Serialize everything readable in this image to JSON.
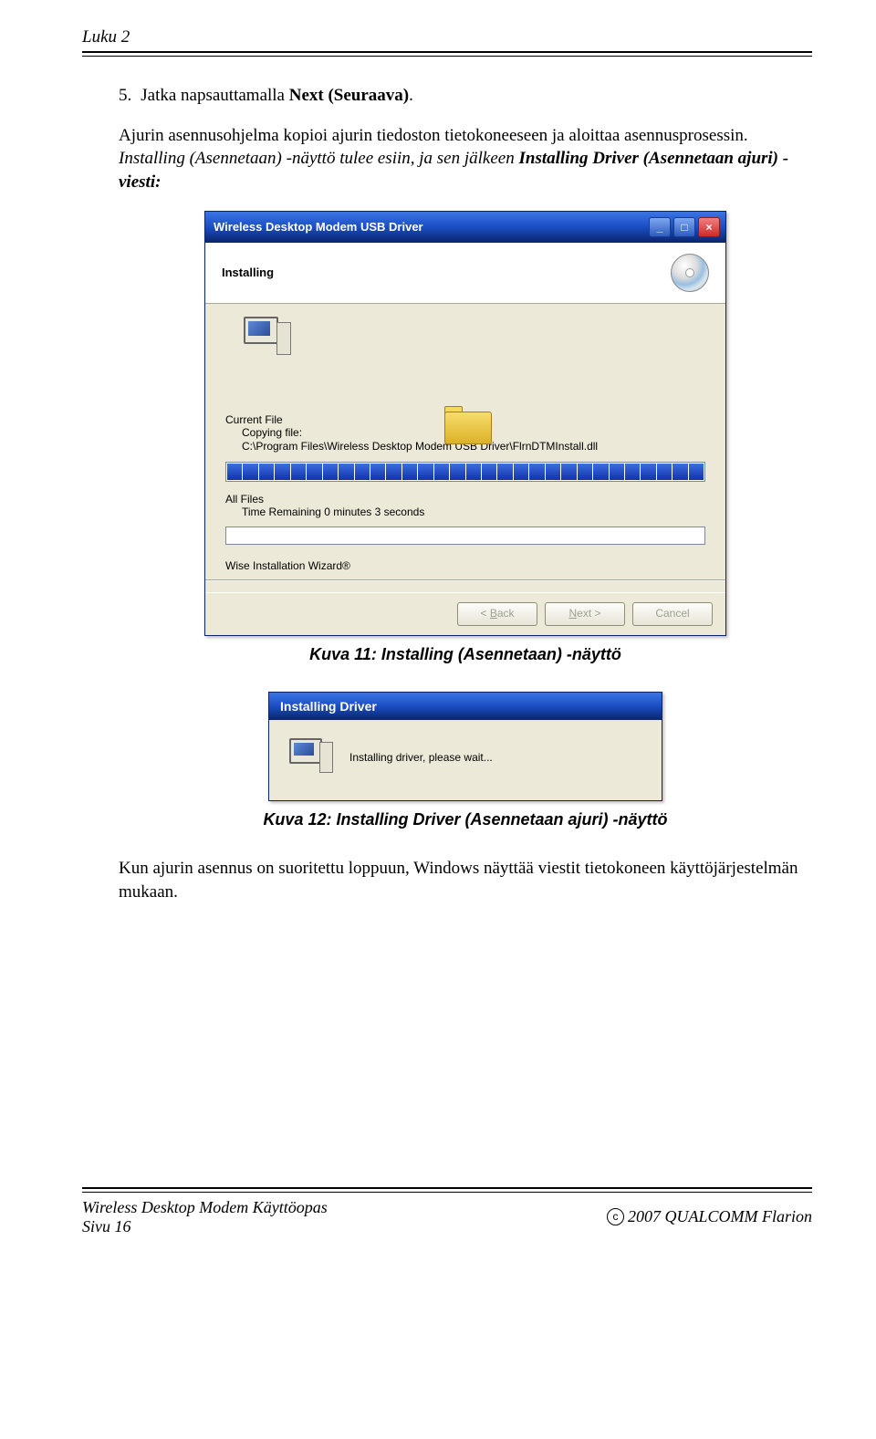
{
  "header": {
    "chapter": "Luku 2"
  },
  "content": {
    "step_num": "5.",
    "step_line1_a": "Jatka napsauttamalla ",
    "step_line1_b": "Next (Seuraava)",
    "step_line1_c": ".",
    "para1": "Ajurin asennusohjelma kopioi ajurin tiedoston tietokoneeseen ja aloittaa asennusprosessin. ",
    "para1_ital_a": "Installing (Asennetaan) -näyttö tulee esiin, ja sen jälkeen ",
    "para1_ital_b": "Installing Driver (Asennetaan ajuri) -viesti:",
    "caption1": "Kuva 11: Installing (Asennetaan) -näyttö",
    "caption2": "Kuva 12: Installing Driver (Asennetaan ajuri) -näyttö",
    "para2": "Kun ajurin asennus on suoritettu loppuun, Windows näyttää viestit tietokoneen käyttöjärjestelmän mukaan."
  },
  "dialog1": {
    "title": "Wireless Desktop Modem USB Driver",
    "heading": "Installing",
    "currentFileLabel": "Current File",
    "copyingLabel": "Copying file:",
    "filepath": "C:\\Program Files\\Wireless Desktop Modem USB Driver\\FlrnDTMInstall.dll",
    "allFilesLabel": "All Files",
    "timeRemaining": "Time Remaining 0 minutes 3 seconds",
    "wizardBrand": "Wise Installation Wizard®",
    "btnBack": "< Back",
    "btnNext": "Next >",
    "btnCancel": "Cancel"
  },
  "dialog2": {
    "title": "Installing Driver",
    "message": "Installing driver, please wait..."
  },
  "footer": {
    "left1": "Wireless Desktop Modem Käyttöopas",
    "left2": "Sivu 16",
    "right_pre": "",
    "right_year_brand": "2007 QUALCOMM Flarion"
  }
}
